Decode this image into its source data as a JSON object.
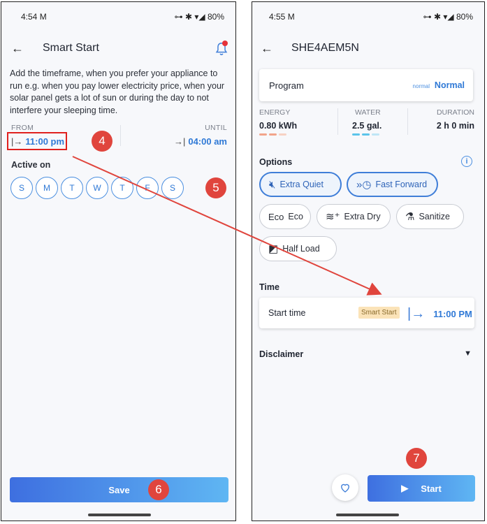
{
  "left": {
    "status": {
      "time": "4:54 M",
      "battery": "80%"
    },
    "title": "Smart Start",
    "description": "Add the timeframe, when you prefer your appliance to run e.g. when you pay lower electricity price, when your solar panel gets a lot of sun or during the day to not interfere your sleeping time.",
    "from_label": "FROM",
    "from_value": "11:00 pm",
    "until_label": "UNTIL",
    "until_value": "04:00 am",
    "active_on_label": "Active on",
    "days": [
      "S",
      "M",
      "T",
      "W",
      "T",
      "F",
      "S"
    ],
    "save_label": "Save"
  },
  "right": {
    "status": {
      "time": "4:55 M",
      "battery": "80%"
    },
    "title": "SHE4AEM5N",
    "program_label": "Program",
    "program_small": "normal",
    "program_value": "Normal",
    "stats": [
      {
        "label": "ENERGY",
        "value": "0.80 kWh"
      },
      {
        "label": "WATER",
        "value": "2.5 gal."
      },
      {
        "label": "DURATION",
        "value": "2 h 0 min"
      }
    ],
    "options_label": "Options",
    "options": [
      {
        "label": "Extra Quiet",
        "icon": "Q"
      },
      {
        "label": "Fast Forward",
        "icon": "»"
      },
      {
        "label": "Eco",
        "icon": "Eco"
      },
      {
        "label": "Extra Dry",
        "icon": "≋"
      },
      {
        "label": "Sanitize",
        "icon": "⚗"
      },
      {
        "label": "Half Load",
        "icon": "◩"
      }
    ],
    "time_label": "Time",
    "start_time_label": "Start time",
    "smart_start_tag": "Smart Start",
    "start_time_value": "11:00 PM",
    "disclaimer_label": "Disclaimer",
    "start_label": "Start"
  },
  "annotations": [
    "4",
    "5",
    "6",
    "7"
  ],
  "colors": {
    "accent": "#2f79d6",
    "badge": "#e0453d",
    "arrow": "#e0453d",
    "highlight_box": "#e0201e"
  }
}
